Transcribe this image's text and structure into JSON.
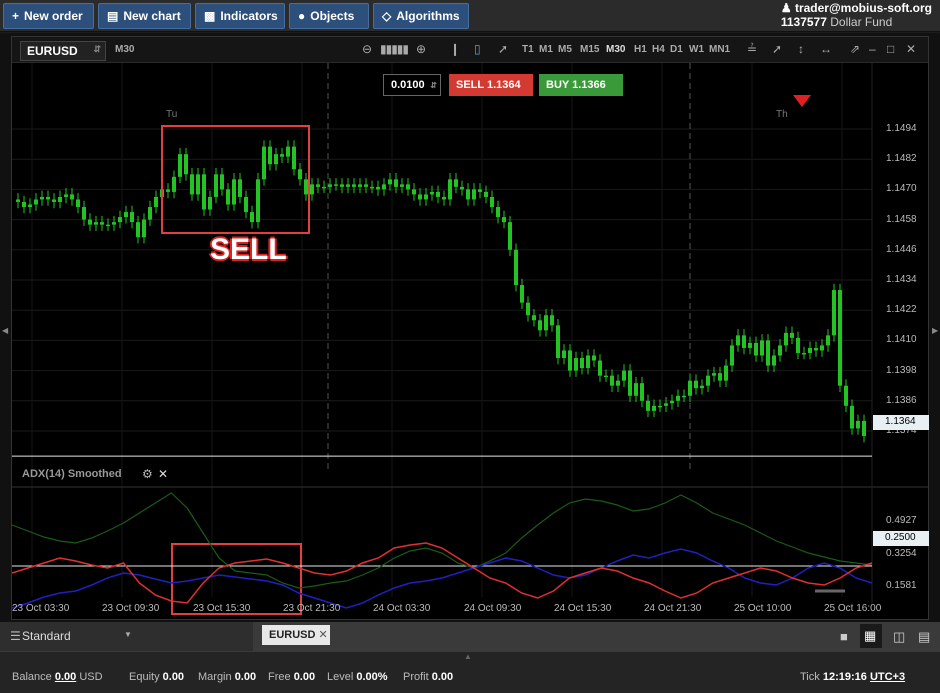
{
  "toolbar": {
    "new_order": "New order",
    "new_chart": "New chart",
    "indicators": "Indicators",
    "objects": "Objects",
    "algorithms": "Algorithms"
  },
  "account": {
    "user": "trader@mobius-soft.org",
    "number": "1137577",
    "fund": "Dollar Fund"
  },
  "chart": {
    "symbol": "EURUSD",
    "timeframe": "M30",
    "timeframes": [
      "T1",
      "M1",
      "M5",
      "M15",
      "M30",
      "H1",
      "H4",
      "D1",
      "W1",
      "MN1"
    ],
    "active_timeframe": "M30",
    "lot": "0.0100",
    "sell_label": "SELL 1.1364",
    "buy_label": "BUY 1.1366",
    "day_labels": [
      "Tu",
      "Th"
    ],
    "annotation": "SELL",
    "current_price": "1.1364",
    "price_ticks": [
      "1.1494",
      "1.1482",
      "1.1470",
      "1.1458",
      "1.1446",
      "1.1434",
      "1.1422",
      "1.1410",
      "1.1398",
      "1.1386",
      "1.1374"
    ],
    "indicator_title": "ADX(14) Smoothed",
    "indicator_ticks": [
      "0.4927",
      "0.3254",
      "0.1581"
    ],
    "indicator_level": "0.2500",
    "time_labels": [
      "23 Oct 03:30",
      "23 Oct 09:30",
      "23 Oct 15:30",
      "23 Oct 21:30",
      "24 Oct 03:30",
      "24 Oct 09:30",
      "24 Oct 15:30",
      "24 Oct 21:30",
      "25 Oct 10:00",
      "25 Oct 16:00"
    ]
  },
  "workspace": {
    "layout": "Standard",
    "tab": "EURUSD"
  },
  "status": {
    "balance_label": "Balance",
    "balance": "0.00",
    "currency": "USD",
    "equity_label": "Equity",
    "equity": "0.00",
    "margin_label": "Margin",
    "margin": "0.00",
    "free_label": "Free",
    "free": "0.00",
    "level_label": "Level",
    "level": "0.00%",
    "profit_label": "Profit",
    "profit": "0.00",
    "tick_label": "Tick",
    "time": "12:19:16",
    "timezone": "UTC+3"
  },
  "colors": {
    "bull": "#22c322",
    "sell": "#d23a32",
    "buy": "#3a9a3a",
    "adx": "#1a5c1a",
    "dip": "#2020c0",
    "dim": "#e03030"
  }
}
